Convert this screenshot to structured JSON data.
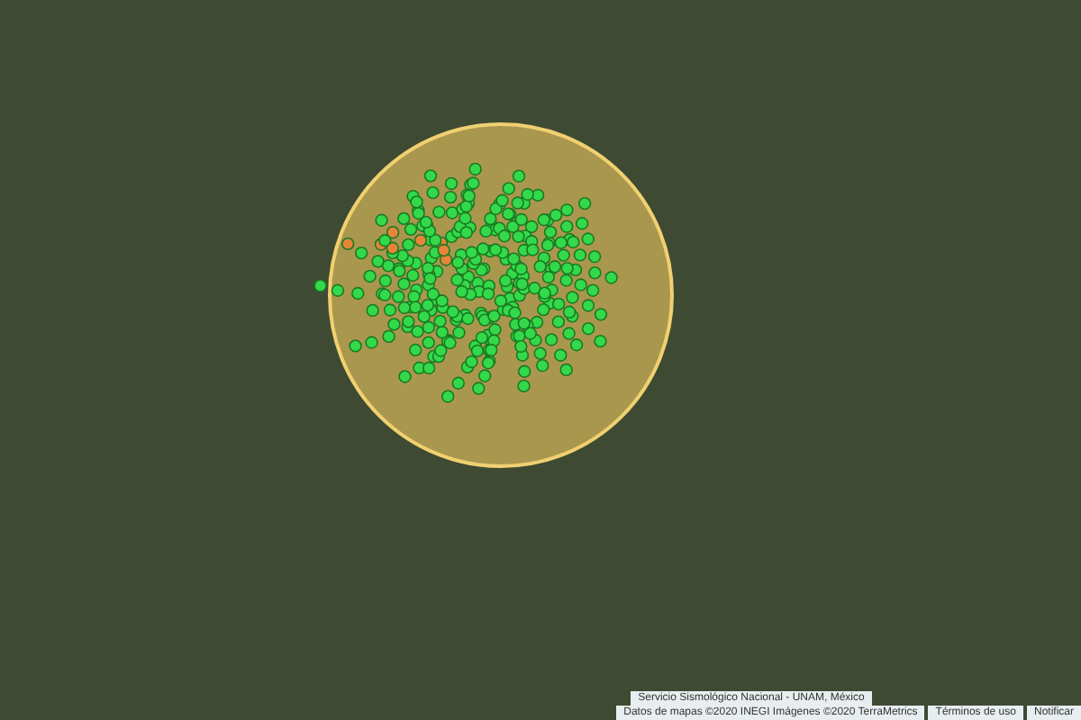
{
  "attribution": {
    "source": "Servicio Sismológico Nacional - UNAM, México",
    "map_data": "Datos de mapas ©2020 INEGI Imágenes ©2020 TerraMetrics",
    "links": [
      "Términos de uso",
      "Notificar"
    ]
  }
}
